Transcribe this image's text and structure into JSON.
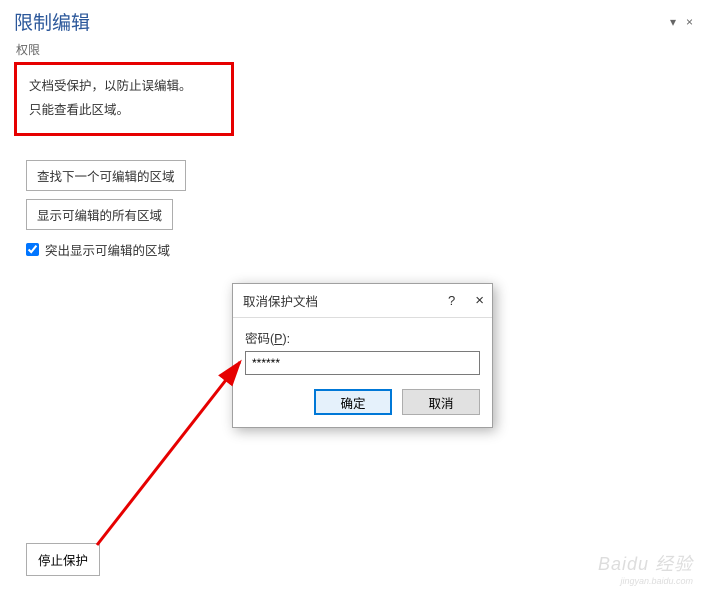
{
  "pane": {
    "title": "限制编辑",
    "dropdown_glyph": "▾",
    "close_glyph": "×",
    "section_label": "权限",
    "protect_text_line1": "文档受保护，以防止误编辑。",
    "protect_text_line2": "只能查看此区域。",
    "find_next_btn": "查找下一个可编辑的区域",
    "show_all_btn": "显示可编辑的所有区域",
    "highlight_checkbox_label": "突出显示可编辑的区域",
    "highlight_checked": true,
    "stop_protect_btn": "停止保护"
  },
  "dialog": {
    "title": "取消保护文档",
    "help_glyph": "?",
    "close_glyph": "×",
    "password_label_prefix": "密码(",
    "password_label_key": "P",
    "password_label_suffix": "):",
    "password_value": "******",
    "ok_btn": "确定",
    "cancel_btn": "取消"
  },
  "watermark": {
    "brand": "Baidu 经验",
    "url": "jingyan.baidu.com"
  }
}
